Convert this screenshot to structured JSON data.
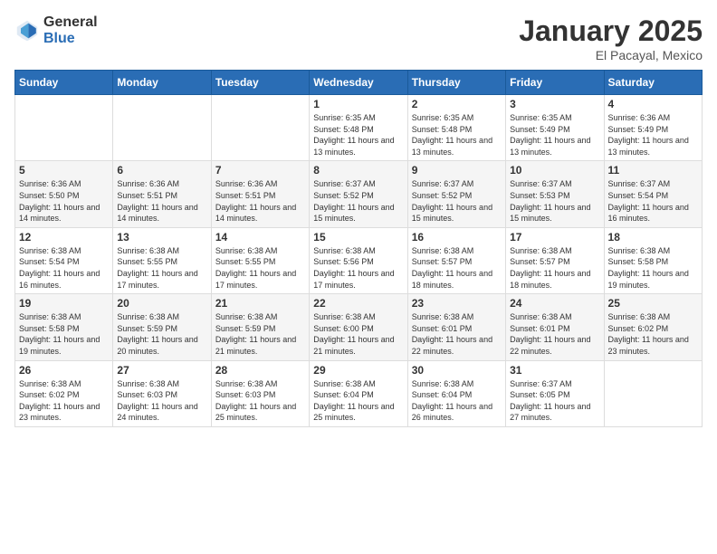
{
  "logo": {
    "general": "General",
    "blue": "Blue"
  },
  "header": {
    "month": "January 2025",
    "location": "El Pacayal, Mexico"
  },
  "days_of_week": [
    "Sunday",
    "Monday",
    "Tuesday",
    "Wednesday",
    "Thursday",
    "Friday",
    "Saturday"
  ],
  "weeks": [
    [
      {
        "day": "",
        "sunrise": "",
        "sunset": "",
        "daylight": ""
      },
      {
        "day": "",
        "sunrise": "",
        "sunset": "",
        "daylight": ""
      },
      {
        "day": "",
        "sunrise": "",
        "sunset": "",
        "daylight": ""
      },
      {
        "day": "1",
        "sunrise": "6:35 AM",
        "sunset": "5:48 PM",
        "daylight": "11 hours and 13 minutes."
      },
      {
        "day": "2",
        "sunrise": "6:35 AM",
        "sunset": "5:48 PM",
        "daylight": "11 hours and 13 minutes."
      },
      {
        "day": "3",
        "sunrise": "6:35 AM",
        "sunset": "5:49 PM",
        "daylight": "11 hours and 13 minutes."
      },
      {
        "day": "4",
        "sunrise": "6:36 AM",
        "sunset": "5:49 PM",
        "daylight": "11 hours and 13 minutes."
      }
    ],
    [
      {
        "day": "5",
        "sunrise": "6:36 AM",
        "sunset": "5:50 PM",
        "daylight": "11 hours and 14 minutes."
      },
      {
        "day": "6",
        "sunrise": "6:36 AM",
        "sunset": "5:51 PM",
        "daylight": "11 hours and 14 minutes."
      },
      {
        "day": "7",
        "sunrise": "6:36 AM",
        "sunset": "5:51 PM",
        "daylight": "11 hours and 14 minutes."
      },
      {
        "day": "8",
        "sunrise": "6:37 AM",
        "sunset": "5:52 PM",
        "daylight": "11 hours and 15 minutes."
      },
      {
        "day": "9",
        "sunrise": "6:37 AM",
        "sunset": "5:52 PM",
        "daylight": "11 hours and 15 minutes."
      },
      {
        "day": "10",
        "sunrise": "6:37 AM",
        "sunset": "5:53 PM",
        "daylight": "11 hours and 15 minutes."
      },
      {
        "day": "11",
        "sunrise": "6:37 AM",
        "sunset": "5:54 PM",
        "daylight": "11 hours and 16 minutes."
      }
    ],
    [
      {
        "day": "12",
        "sunrise": "6:38 AM",
        "sunset": "5:54 PM",
        "daylight": "11 hours and 16 minutes."
      },
      {
        "day": "13",
        "sunrise": "6:38 AM",
        "sunset": "5:55 PM",
        "daylight": "11 hours and 17 minutes."
      },
      {
        "day": "14",
        "sunrise": "6:38 AM",
        "sunset": "5:55 PM",
        "daylight": "11 hours and 17 minutes."
      },
      {
        "day": "15",
        "sunrise": "6:38 AM",
        "sunset": "5:56 PM",
        "daylight": "11 hours and 17 minutes."
      },
      {
        "day": "16",
        "sunrise": "6:38 AM",
        "sunset": "5:57 PM",
        "daylight": "11 hours and 18 minutes."
      },
      {
        "day": "17",
        "sunrise": "6:38 AM",
        "sunset": "5:57 PM",
        "daylight": "11 hours and 18 minutes."
      },
      {
        "day": "18",
        "sunrise": "6:38 AM",
        "sunset": "5:58 PM",
        "daylight": "11 hours and 19 minutes."
      }
    ],
    [
      {
        "day": "19",
        "sunrise": "6:38 AM",
        "sunset": "5:58 PM",
        "daylight": "11 hours and 19 minutes."
      },
      {
        "day": "20",
        "sunrise": "6:38 AM",
        "sunset": "5:59 PM",
        "daylight": "11 hours and 20 minutes."
      },
      {
        "day": "21",
        "sunrise": "6:38 AM",
        "sunset": "5:59 PM",
        "daylight": "11 hours and 21 minutes."
      },
      {
        "day": "22",
        "sunrise": "6:38 AM",
        "sunset": "6:00 PM",
        "daylight": "11 hours and 21 minutes."
      },
      {
        "day": "23",
        "sunrise": "6:38 AM",
        "sunset": "6:01 PM",
        "daylight": "11 hours and 22 minutes."
      },
      {
        "day": "24",
        "sunrise": "6:38 AM",
        "sunset": "6:01 PM",
        "daylight": "11 hours and 22 minutes."
      },
      {
        "day": "25",
        "sunrise": "6:38 AM",
        "sunset": "6:02 PM",
        "daylight": "11 hours and 23 minutes."
      }
    ],
    [
      {
        "day": "26",
        "sunrise": "6:38 AM",
        "sunset": "6:02 PM",
        "daylight": "11 hours and 23 minutes."
      },
      {
        "day": "27",
        "sunrise": "6:38 AM",
        "sunset": "6:03 PM",
        "daylight": "11 hours and 24 minutes."
      },
      {
        "day": "28",
        "sunrise": "6:38 AM",
        "sunset": "6:03 PM",
        "daylight": "11 hours and 25 minutes."
      },
      {
        "day": "29",
        "sunrise": "6:38 AM",
        "sunset": "6:04 PM",
        "daylight": "11 hours and 25 minutes."
      },
      {
        "day": "30",
        "sunrise": "6:38 AM",
        "sunset": "6:04 PM",
        "daylight": "11 hours and 26 minutes."
      },
      {
        "day": "31",
        "sunrise": "6:37 AM",
        "sunset": "6:05 PM",
        "daylight": "11 hours and 27 minutes."
      },
      {
        "day": "",
        "sunrise": "",
        "sunset": "",
        "daylight": ""
      }
    ]
  ]
}
